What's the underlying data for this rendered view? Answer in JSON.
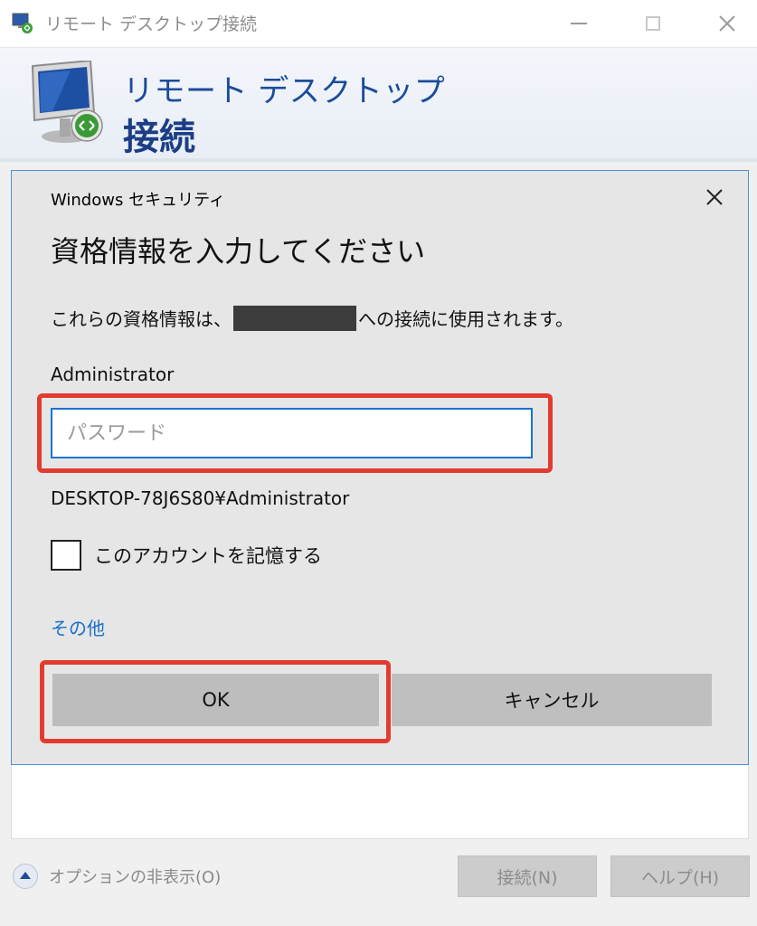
{
  "window": {
    "title": "リモート デスクトップ接続"
  },
  "banner": {
    "line1": "リモート デスクトップ",
    "line2": "接続"
  },
  "dialog": {
    "title": "Windows セキュリティ",
    "heading": "資格情報を入力してください",
    "description_before": "これらの資格情報は、",
    "description_after": "への接続に使用されます。",
    "username": "Administrator",
    "password_value": "",
    "password_placeholder": "パスワード",
    "domain_user": "DESKTOP-78J6S80¥Administrator",
    "remember_label": "このアカウントを記憶する",
    "remember_checked": false,
    "more_choices": "その他",
    "ok_label": "OK",
    "cancel_label": "キャンセル"
  },
  "bottom": {
    "options_label": "オプションの非表示(O)",
    "connect_label": "接続(N)",
    "help_label": "ヘルプ(H)"
  },
  "colors": {
    "highlight": "#e33b2f",
    "link": "#1a6fc9",
    "banner_text": "#1b4c9b",
    "input_focus": "#1a73d9"
  },
  "icons": {
    "app": "remote-desktop-icon",
    "close": "close-icon",
    "options": "chevron-up-circle-icon"
  }
}
